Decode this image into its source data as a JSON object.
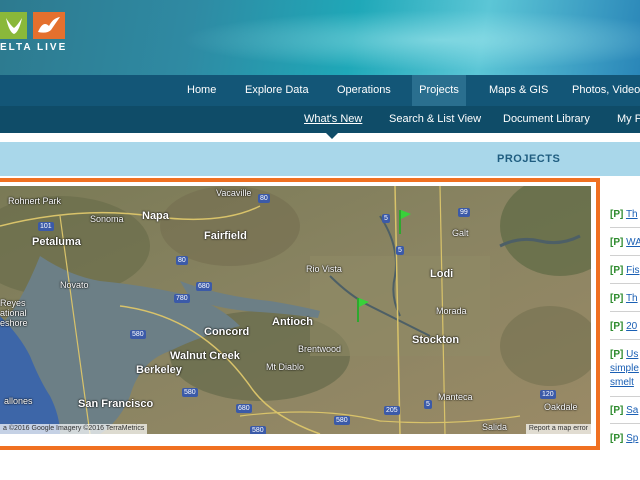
{
  "header": {
    "logo_text": "ELTA LIVE",
    "brand_colors": {
      "green": "#8ab83a",
      "orange": "#e4702e"
    }
  },
  "primary_nav": {
    "items": [
      {
        "label": "Home"
      },
      {
        "label": "Explore Data"
      },
      {
        "label": "Operations"
      },
      {
        "label": "Projects",
        "active": true
      },
      {
        "label": "Maps & GIS"
      },
      {
        "label": "Photos, Video"
      }
    ]
  },
  "secondary_nav": {
    "items": [
      {
        "label": "What's New",
        "current": true
      },
      {
        "label": "Search & List View"
      },
      {
        "label": "Document Library"
      },
      {
        "label": "My P"
      }
    ]
  },
  "section": {
    "title": "PROJECTS"
  },
  "map": {
    "places": [
      "Rohnert Park",
      "Vacaville",
      "Sonoma",
      "Napa",
      "Fairfield",
      "Petaluma",
      "Novato",
      "Rio Vista",
      "Galt",
      "Lodi",
      "Antioch",
      "Concord",
      "Brentwood",
      "Walnut Creek",
      "Mt Diablo",
      "Stockton",
      "Morada",
      "Berkeley",
      "San Francisco",
      "Manteca",
      "Oakdale",
      "Salida",
      "Reyes",
      "ational",
      "eshore",
      "allones"
    ],
    "shields": [
      "101",
      "80",
      "80",
      "680",
      "780",
      "580",
      "580",
      "680",
      "580",
      "205",
      "580",
      "5",
      "5",
      "5",
      "99",
      "120"
    ],
    "attribution": "a ©2016 Google Imagery ©2016 TerraMetrics",
    "report_link": "Report a map error",
    "markers": 2
  },
  "sidebar": {
    "items": [
      {
        "tag": "[P]",
        "text": "Th"
      },
      {
        "tag": "[P]",
        "text": "WA"
      },
      {
        "tag": "[P]",
        "text": "Fis"
      },
      {
        "tag": "[P]",
        "text": "Th"
      },
      {
        "tag": "[P]",
        "text": "20"
      },
      {
        "tag": "[P]",
        "text": "Us",
        "extra": [
          "simple",
          "smelt"
        ]
      },
      {
        "tag": "[P]",
        "text": "Sa"
      },
      {
        "tag": "[P]",
        "text": "Sp"
      }
    ]
  }
}
